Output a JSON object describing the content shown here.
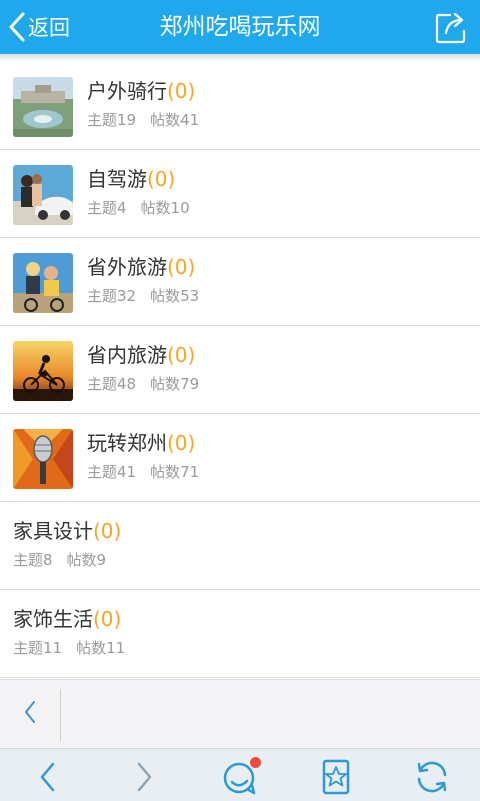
{
  "header": {
    "back_label": "返回",
    "title": "郑州吃喝玩乐网",
    "share_icon": "share-icon",
    "background": "#1fa9ec"
  },
  "forums": [
    {
      "name": "户外骑行",
      "count": "(0)",
      "topics": "主题19",
      "posts": "帖数41",
      "thumb": "park-fountain-photo"
    },
    {
      "name": "自驾游",
      "count": "(0)",
      "topics": "主题4",
      "posts": "帖数10",
      "thumb": "couple-by-car-photo"
    },
    {
      "name": "省外旅游",
      "count": "(0)",
      "topics": "主题32",
      "posts": "帖数53",
      "thumb": "cyclists-on-bikes-photo"
    },
    {
      "name": "省内旅游",
      "count": "(0)",
      "topics": "主题48",
      "posts": "帖数79",
      "thumb": "sunset-cyclist-photo"
    },
    {
      "name": "玩转郑州",
      "count": "(0)",
      "topics": "主题41",
      "posts": "帖数71",
      "thumb": "microphone-photo"
    },
    {
      "name": "家具设计",
      "count": "(0)",
      "topics": "主题8",
      "posts": "帖数9",
      "thumb": null
    },
    {
      "name": "家饰生活",
      "count": "(0)",
      "topics": "主题11",
      "posts": "帖数11",
      "thumb": null
    }
  ],
  "pager": {
    "back_icon": "chevron-left-icon"
  },
  "toolbar": {
    "icons": [
      "back-icon",
      "forward-icon",
      "chat-icon",
      "bookmark-star-icon",
      "refresh-icon"
    ],
    "notification_dot_color": "#f04a3a",
    "icon_color": "#2b9ad6"
  },
  "colors": {
    "count": "#f5a623",
    "title": "#333333",
    "stats": "#9a9a9a"
  }
}
